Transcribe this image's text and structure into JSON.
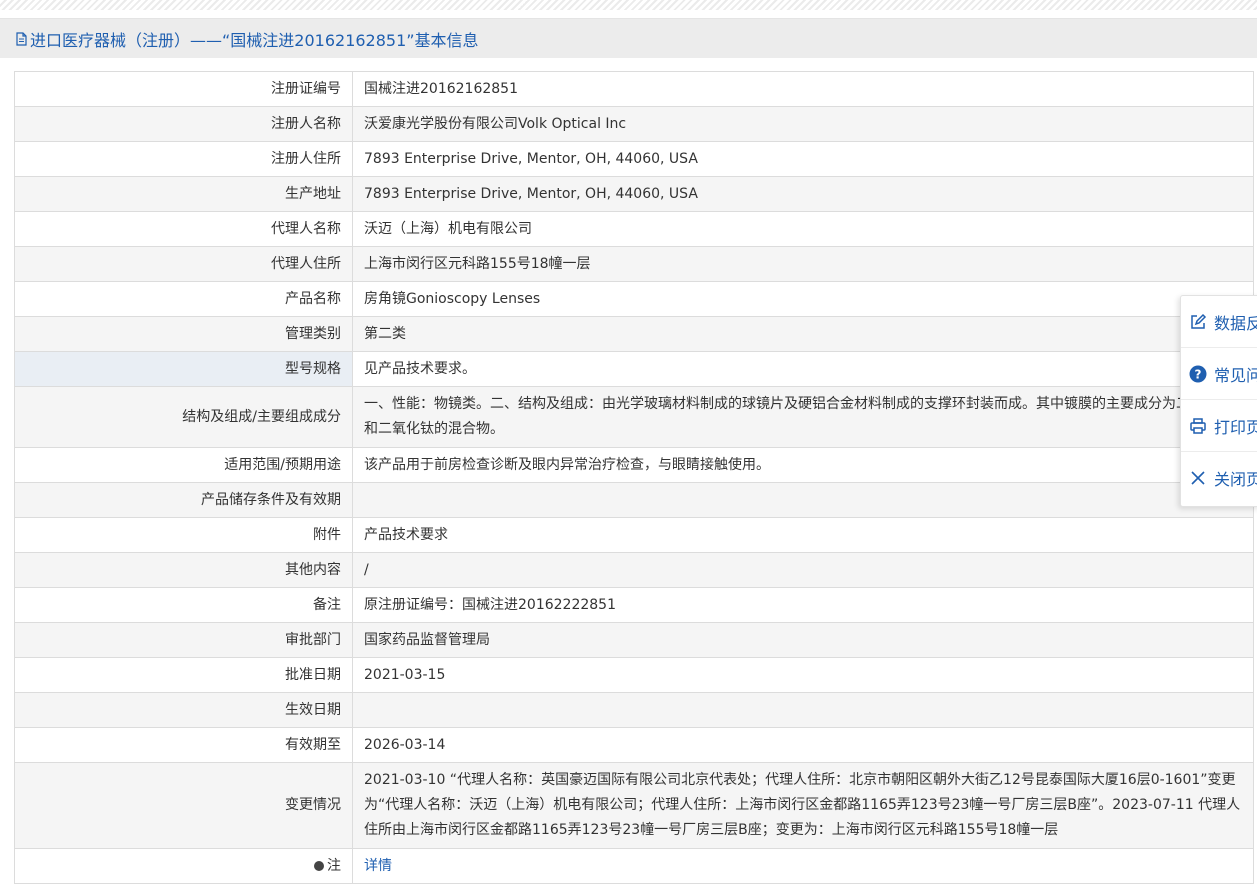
{
  "header": {
    "title": "进口医疗器械（注册）——“国械注进20162162851”基本信息"
  },
  "rows": [
    {
      "label": "注册证编号",
      "value": "国械注进20162162851"
    },
    {
      "label": "注册人名称",
      "value": "沃爱康光学股份有限公司Volk Optical Inc"
    },
    {
      "label": "注册人住所",
      "value": "7893 Enterprise Drive, Mentor, OH, 44060, USA"
    },
    {
      "label": "生产地址",
      "value": "7893 Enterprise Drive, Mentor, OH, 44060, USA"
    },
    {
      "label": "代理人名称",
      "value": "沃迈（上海）机电有限公司"
    },
    {
      "label": "代理人住所",
      "value": "上海市闵行区元科路155号18幢一层"
    },
    {
      "label": "产品名称",
      "value": "房角镜Gonioscopy Lenses"
    },
    {
      "label": "管理类别",
      "value": "第二类"
    },
    {
      "label": "型号规格",
      "value": "见产品技术要求。"
    },
    {
      "label": "结构及组成/主要组成成分",
      "value": "一、性能：物镜类。二、结构及组成：由光学玻璃材料制成的球镜片及硬铝合金材料制成的支撑环封装而成。其中镀膜的主要成分为二氧化钛和二氧化钛的混合物。"
    },
    {
      "label": "适用范围/预期用途",
      "value": "该产品用于前房检查诊断及眼内异常治疗检查，与眼睛接触使用。"
    },
    {
      "label": "产品储存条件及有效期",
      "value": ""
    },
    {
      "label": "附件",
      "value": "产品技术要求"
    },
    {
      "label": "其他内容",
      "value": "/"
    },
    {
      "label": "备注",
      "value": "原注册证编号：国械注进20162222851"
    },
    {
      "label": "审批部门",
      "value": "国家药品监督管理局"
    },
    {
      "label": "批准日期",
      "value": "2021-03-15"
    },
    {
      "label": "生效日期",
      "value": ""
    },
    {
      "label": "有效期至",
      "value": "2026-03-14"
    },
    {
      "label": "变更情况",
      "value": "2021-03-10 “代理人名称：英国豪迈国际有限公司北京代表处；代理人住所：北京市朝阳区朝外大街乙12号昆泰国际大厦16层0-1601”变更为“代理人名称：沃迈（上海）机电有限公司；代理人住所：上海市闵行区金都路1165弄123号23幢一号厂房三层B座”。2023-07-11 代理人住所由上海市闵行区金都路1165弄123号23幢一号厂房三层B座；变更为：上海市闵行区元科路155号18幢一层"
    },
    {
      "label": "注",
      "value": "详情"
    }
  ],
  "side_panel": {
    "items": [
      {
        "label": "数据反馈",
        "icon": "edit-icon"
      },
      {
        "label": "常见问题",
        "icon": "question-icon"
      },
      {
        "label": "打印页面",
        "icon": "print-icon"
      },
      {
        "label": "关闭页面",
        "icon": "close-icon"
      }
    ]
  },
  "colors": {
    "accent": "#1f5fb0",
    "title_bar_bg": "#ececec",
    "row_alt_bg": "#f5f5f5",
    "border": "#dcdcdc"
  }
}
